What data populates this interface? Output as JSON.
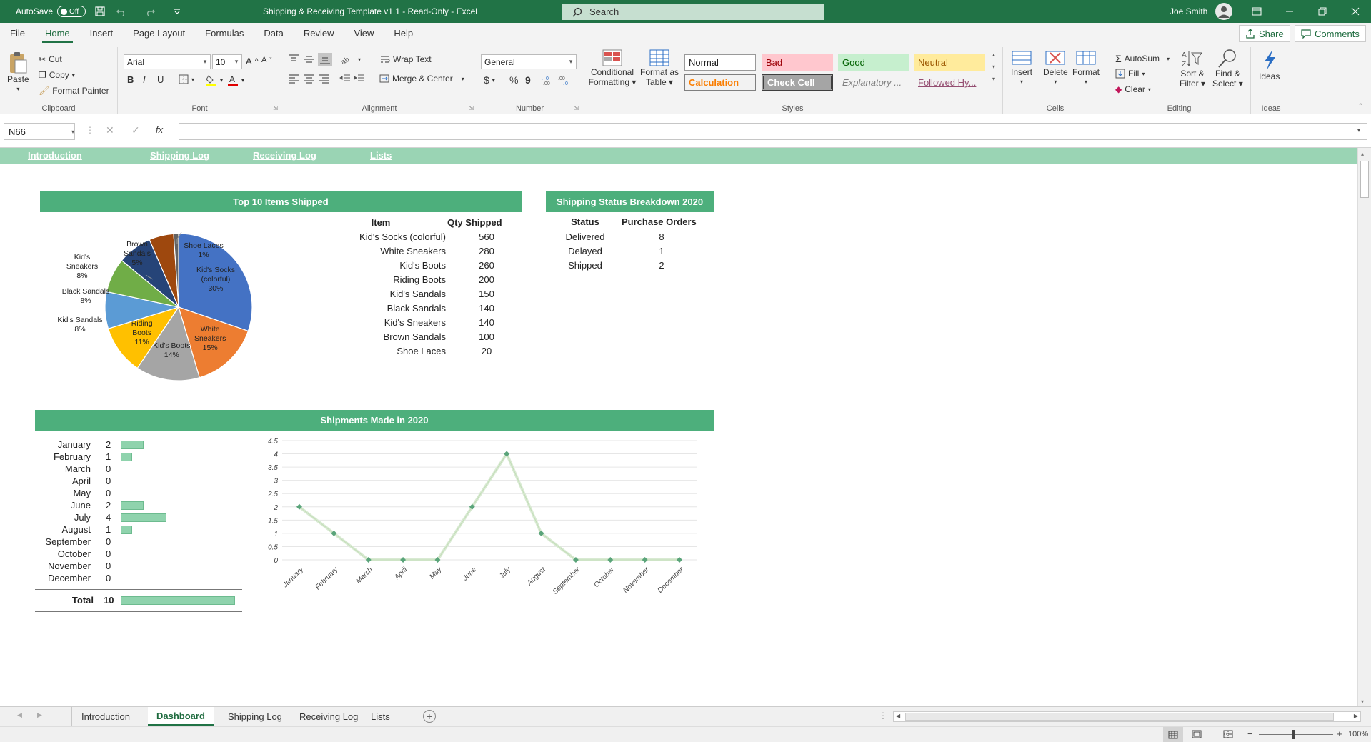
{
  "titlebar": {
    "autosave_label": "AutoSave",
    "autosave_state": "Off",
    "doc_title": "Shipping & Receiving Template v1.1  -  Read-Only  -  Excel",
    "search_placeholder": "Search",
    "user_name": "Joe Smith"
  },
  "menu": {
    "tabs": [
      "File",
      "Home",
      "Insert",
      "Page Layout",
      "Formulas",
      "Data",
      "Review",
      "View",
      "Help"
    ],
    "active": "Home",
    "share_label": "Share",
    "comments_label": "Comments"
  },
  "ribbon": {
    "clipboard": {
      "paste": "Paste",
      "cut": "Cut",
      "copy": "Copy",
      "format_painter": "Format Painter",
      "label": "Clipboard"
    },
    "font": {
      "name": "Arial",
      "size": "10",
      "label": "Font",
      "bold": "B",
      "italic": "I",
      "underline": "U"
    },
    "alignment": {
      "wrap_text": "Wrap Text",
      "merge_center": "Merge & Center",
      "label": "Alignment"
    },
    "number": {
      "format": "General",
      "currency": "$",
      "percent": "%",
      "comma": "9",
      "label": "Number"
    },
    "styles": {
      "conditional_formatting": [
        "Conditional",
        "Formatting"
      ],
      "format_as_table": [
        "Format as",
        "Table"
      ],
      "cells": [
        "Normal",
        "Bad",
        "Good",
        "Neutral",
        "Calculation",
        "Check Cell",
        "Explanatory ...",
        "Followed Hy..."
      ],
      "label": "Styles"
    },
    "cells": {
      "insert": "Insert",
      "delete": "Delete",
      "format": "Format",
      "label": "Cells"
    },
    "editing": {
      "autosum": "AutoSum",
      "fill": "Fill",
      "clear": "Clear",
      "sort_filter": [
        "Sort &",
        "Filter"
      ],
      "find_select": [
        "Find &",
        "Select"
      ],
      "label": "Editing"
    },
    "ideas": {
      "button": "Ideas",
      "label": "Ideas"
    }
  },
  "formula_bar": {
    "name_box": "N66",
    "formula": "",
    "fx": "fx"
  },
  "nav_links": [
    "Introduction",
    "Shipping Log",
    "Receiving Log",
    "Lists"
  ],
  "pie_section": {
    "title": "Top 10 Items Shipped",
    "chart_data": {
      "type": "pie",
      "slices": [
        {
          "label": "Kid's Socks (colorful)",
          "pct_label": "30%",
          "value": 560,
          "color": "#4472c4"
        },
        {
          "label": "White Sneakers",
          "pct_label": "15%",
          "value": 280,
          "color": "#ed7d31"
        },
        {
          "label": "Kid's Boots",
          "pct_label": "14%",
          "value": 260,
          "color": "#a5a5a5"
        },
        {
          "label": "Riding Boots",
          "pct_label": "11%",
          "value": 200,
          "color": "#ffc000"
        },
        {
          "label": "Kid's Sandals",
          "pct_label": "8%",
          "value": 150,
          "color": "#5b9bd5"
        },
        {
          "label": "Black Sandals",
          "pct_label": "8%",
          "value": 140,
          "color": "#70ad47"
        },
        {
          "label": "Kid's Sneakers",
          "pct_label": "8%",
          "value": 140,
          "color": "#264478"
        },
        {
          "label": "Brown Sandals",
          "pct_label": "5%",
          "value": 100,
          "color": "#9e480e"
        },
        {
          "label": "Shoe Laces",
          "pct_label": "1%",
          "value": 20,
          "color": "#636363"
        }
      ]
    },
    "table_headers": [
      "Item",
      "Qty Shipped"
    ],
    "rows": [
      [
        "Kid's Socks (colorful)",
        "560"
      ],
      [
        "White Sneakers",
        "280"
      ],
      [
        "Kid's Boots",
        "260"
      ],
      [
        "Riding Boots",
        "200"
      ],
      [
        "Kid's Sandals",
        "150"
      ],
      [
        "Black Sandals",
        "140"
      ],
      [
        "Kid's Sneakers",
        "140"
      ],
      [
        "Brown Sandals",
        "100"
      ],
      [
        "Shoe Laces",
        "20"
      ]
    ]
  },
  "status_section": {
    "title": "Shipping Status Breakdown 2020",
    "headers": [
      "Status",
      "Purchase Orders"
    ],
    "rows": [
      [
        "Delivered",
        "8"
      ],
      [
        "Delayed",
        "1"
      ],
      [
        "Shipped",
        "2"
      ]
    ]
  },
  "shipments_section": {
    "title": "Shipments Made in 2020",
    "total_label": "Total",
    "total_value": "10",
    "chart_data": {
      "type": "line",
      "categories": [
        "January",
        "February",
        "March",
        "April",
        "May",
        "June",
        "July",
        "August",
        "September",
        "October",
        "November",
        "December"
      ],
      "values": [
        2,
        1,
        0,
        0,
        0,
        2,
        4,
        1,
        0,
        0,
        0,
        0
      ],
      "ylim": [
        0,
        4.5
      ],
      "yticks": [
        "0",
        "0.5",
        "1",
        "1.5",
        "2",
        "2.5",
        "3",
        "3.5",
        "4",
        "4.5"
      ],
      "line_color": "#d9ead3",
      "marker_color": "#5aa47a"
    },
    "bar_max": 10,
    "bar_color": "#8fd3ad"
  },
  "sheet_tabs": {
    "tabs": [
      "Introduction",
      "Dashboard",
      "Shipping Log",
      "Receiving Log",
      "Lists"
    ],
    "active": "Dashboard"
  },
  "status_bar": {
    "zoom": "100%"
  }
}
